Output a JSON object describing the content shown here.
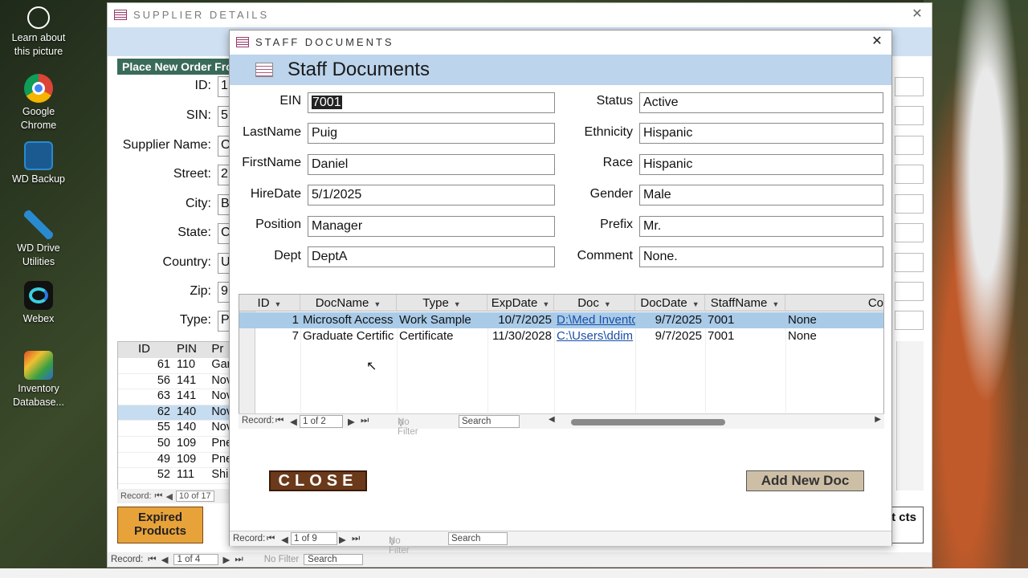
{
  "desktop": {
    "icons": [
      {
        "label": "Learn about this picture",
        "icon": "camera-icon"
      },
      {
        "label": "Google Chrome",
        "icon": "chrome-icon"
      },
      {
        "label": "WD Backup",
        "icon": "wd-backup-icon"
      },
      {
        "label": "WD Drive Utilities",
        "icon": "wd-utilities-icon"
      },
      {
        "label": "Webex",
        "icon": "webex-icon"
      },
      {
        "label": "Inventory Database...",
        "icon": "access-db-icon"
      }
    ]
  },
  "supplier": {
    "title": "SUPPLIER DETAILS",
    "place_order": "Place New Order From",
    "labels": [
      "ID:",
      "SIN:",
      "Supplier Name:",
      "Street:",
      "City:",
      "State:",
      "Country:",
      "Zip:",
      "Type:"
    ],
    "values": [
      "1",
      "5",
      "O",
      "2",
      "B",
      "C",
      "U",
      "9",
      "P"
    ],
    "grid_headers": [
      "ID",
      "PIN",
      "Pr"
    ],
    "grid_rows": [
      {
        "id": "61",
        "pin": "110",
        "pr": "Gar"
      },
      {
        "id": "56",
        "pin": "141",
        "pr": "Nov"
      },
      {
        "id": "63",
        "pin": "141",
        "pr": "Nov"
      },
      {
        "id": "62",
        "pin": "140",
        "pr": "Nov"
      },
      {
        "id": "55",
        "pin": "140",
        "pr": "Nov"
      },
      {
        "id": "50",
        "pin": "109",
        "pr": "Pne"
      },
      {
        "id": "49",
        "pin": "109",
        "pr": "Pne"
      },
      {
        "id": "52",
        "pin": "111",
        "pr": "Shi"
      }
    ],
    "grid_record": "10 of 17",
    "expired_button": "Expired Products",
    "right_button": "nt cts",
    "record_label": "Record:",
    "record_value": "1 of 4",
    "no_filter": "No Filter",
    "search": "Search"
  },
  "staff": {
    "window_title": "STAFF DOCUMENTS",
    "header_title": "Staff Documents",
    "left_fields": [
      {
        "label": "EIN",
        "value": "7001"
      },
      {
        "label": "LastName",
        "value": "Puig"
      },
      {
        "label": "FirstName",
        "value": "Daniel"
      },
      {
        "label": "HireDate",
        "value": "5/1/2025"
      },
      {
        "label": "Position",
        "value": "Manager"
      },
      {
        "label": "Dept",
        "value": "DeptA"
      }
    ],
    "right_fields": [
      {
        "label": "Status",
        "value": "Active"
      },
      {
        "label": "Ethnicity",
        "value": "Hispanic"
      },
      {
        "label": "Race",
        "value": "Hispanic"
      },
      {
        "label": "Gender",
        "value": "Male"
      },
      {
        "label": "Prefix",
        "value": "Mr."
      },
      {
        "label": "Comment",
        "value": "None."
      }
    ],
    "grid": {
      "headers": [
        "ID",
        "DocName",
        "Type",
        "ExpDate",
        "Doc",
        "DocDate",
        "StaffName",
        "Co"
      ],
      "rows": [
        {
          "id": "1",
          "docname": "Microsoft Access",
          "type": "Work Sample",
          "expdate": "10/7/2025",
          "doc": "D:\\Med Invento",
          "docdate": "9/7/2025",
          "staff": "7001",
          "comment": "None"
        },
        {
          "id": "7",
          "docname": "Graduate Certific",
          "type": "Certificate",
          "expdate": "11/30/2028",
          "doc": "C:\\Users\\ddim",
          "docdate": "9/7/2025",
          "staff": "7001",
          "comment": "None"
        }
      ],
      "record_label": "Record:",
      "record_value": "1 of 2",
      "no_filter": "No Filter",
      "search": "Search"
    },
    "close_button": "CLOSE",
    "add_button": "Add New Doc",
    "record_label": "Record:",
    "record_value": "1 of 9",
    "no_filter": "No Filter",
    "search": "Search"
  },
  "colors": {
    "header_band": "#bcd4ec",
    "selected_row": "#a9cbe8",
    "close_button": "#6b3a1a",
    "add_button": "#cdbfa6",
    "expired_button": "#e8a23a"
  }
}
